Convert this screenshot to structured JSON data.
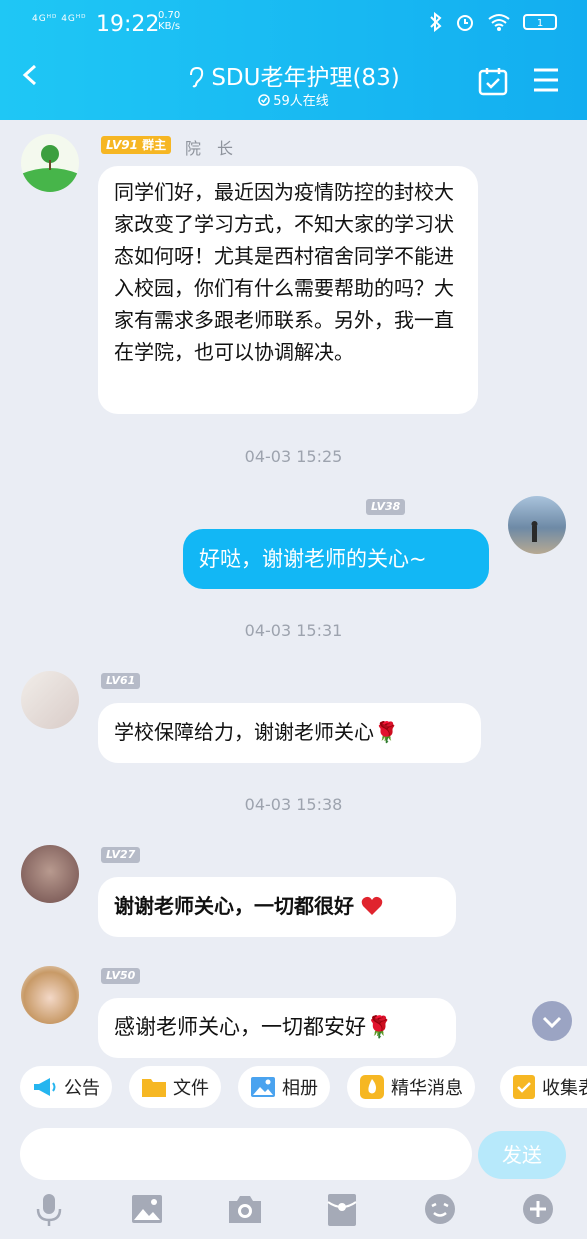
{
  "status_bar": {
    "signal": "4Gᴴᴰ 4Gᴴᴰ",
    "time": "19:22",
    "speed_value": "0.70",
    "speed_unit": "KB/s",
    "battery": "1"
  },
  "header": {
    "title": "SDU老年护理(83)",
    "online": "59人在线"
  },
  "messages": [
    {
      "level": "LV91",
      "role_badge": "群主",
      "name": "院　长",
      "text": "同学们好，最近因为疫情防控的封校大家改变了学习方式，不知大家的学习状态如何呀！尤其是西村宿舍同学不能进入校园，你们有什么需要帮助的吗？大家有需求多跟老师联系。另外，我一直在学院，也可以协调解决。"
    },
    {
      "time": "04-03 15:25"
    },
    {
      "level": "LV38",
      "text": "好哒，谢谢老师的关心~"
    },
    {
      "time": "04-03 15:31"
    },
    {
      "level": "LV61",
      "text": "学校保障给力，谢谢老师关心🌹"
    },
    {
      "time": "04-03 15:38"
    },
    {
      "level": "LV27",
      "text": "谢谢老师关心，一切都很好"
    },
    {
      "level": "LV50",
      "text": "感谢老师关心，一切都安好🌹"
    }
  ],
  "quick_actions": [
    "公告",
    "文件",
    "相册",
    "精华消息",
    "收集表"
  ],
  "composer": {
    "send_label": "发送"
  },
  "colors": {
    "accent": "#13aef0",
    "bubble_self": "#12b7f5",
    "badge_owner": "#f7b928"
  }
}
